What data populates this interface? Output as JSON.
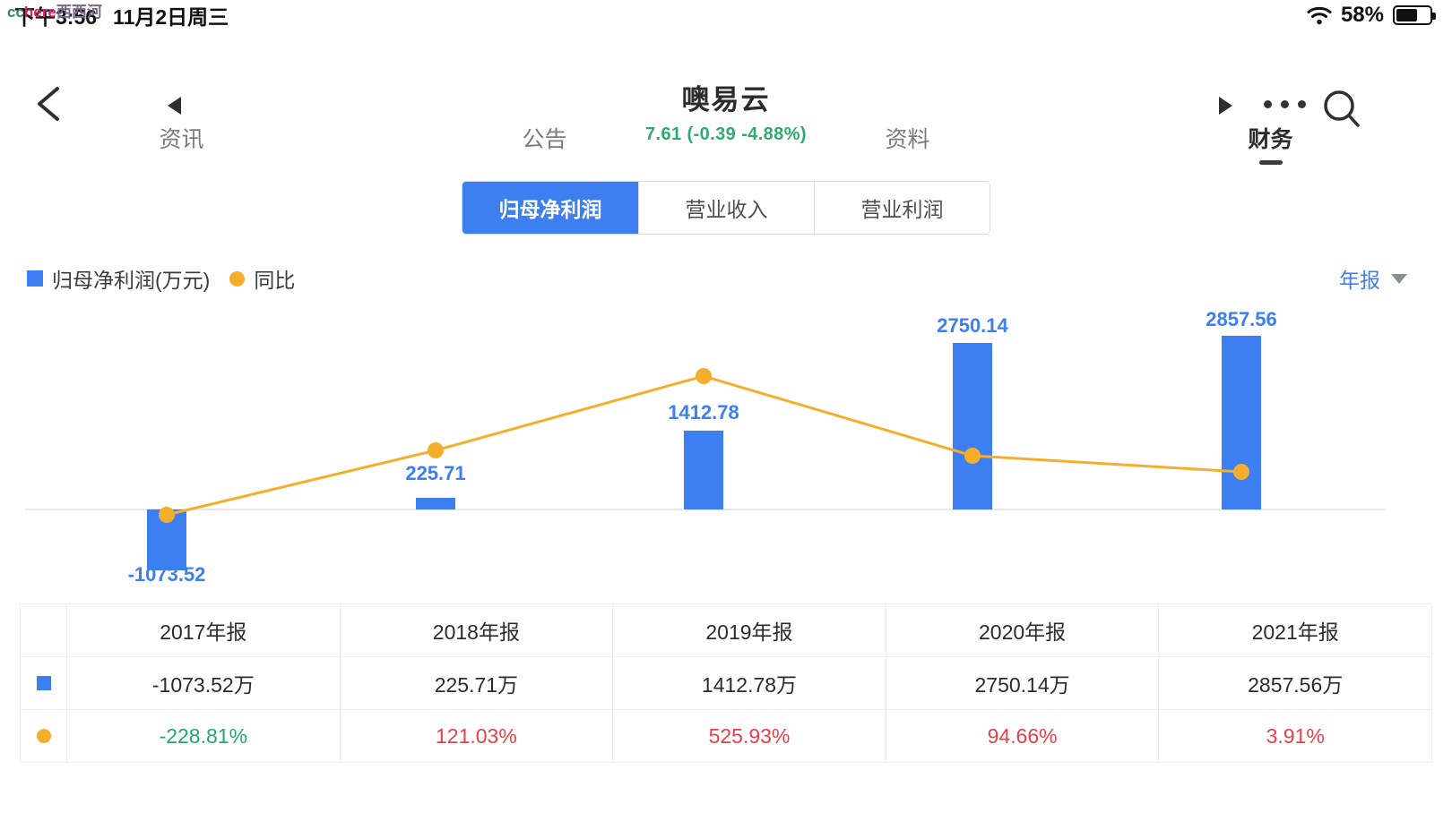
{
  "statusbar": {
    "time": "下午3:56",
    "date": "11月2日周三",
    "battery_pct": "58%",
    "watermark": {
      "part1": "cc",
      "part2": "here",
      "part3": "西西河"
    },
    "wifi_icon": "wifi-icon",
    "battery_icon": "battery-icon"
  },
  "header": {
    "back_icon": "chevron-left-icon",
    "prev_icon": "triangle-left-icon",
    "next_icon": "triangle-right-icon",
    "more_icon": "ellipsis-icon",
    "search_icon": "search-icon",
    "title": "噢易云",
    "quote": "7.61 (-0.39 -4.88%)",
    "quote_color": "#2bab6e"
  },
  "tabs": [
    {
      "label": "资讯",
      "active": false
    },
    {
      "label": "公告",
      "active": false
    },
    {
      "label": "资料",
      "active": false
    },
    {
      "label": "财务",
      "active": true
    }
  ],
  "segments": [
    {
      "label": "归母净利润",
      "active": true
    },
    {
      "label": "营业收入",
      "active": false
    },
    {
      "label": "营业利润",
      "active": false
    }
  ],
  "legend": [
    {
      "marker": "square",
      "label": "归母净利润(万元)",
      "color": "#3d7ff0"
    },
    {
      "marker": "dot",
      "label": "同比",
      "color": "#f5ae2c"
    }
  ],
  "period_selector": {
    "label": "年报",
    "caret_icon": "caret-down-icon"
  },
  "chart_data": {
    "type": "bar",
    "title": "归母净利润(万元)",
    "categories": [
      "2017年报",
      "2018年报",
      "2019年报",
      "2020年报",
      "2021年报"
    ],
    "series": [
      {
        "name": "归母净利润(万元)",
        "type": "bar",
        "color": "#3d7ff0",
        "values": [
          -1073.52,
          225.71,
          1412.78,
          2750.14,
          2857.56
        ],
        "labels": [
          "-1073.52",
          "225.71",
          "1412.78",
          "2750.14",
          "2857.56"
        ]
      },
      {
        "name": "同比",
        "type": "line",
        "color": "#f5ae2c",
        "values": [
          -228.81,
          121.03,
          525.93,
          94.66,
          3.91
        ],
        "unit": "%"
      }
    ],
    "ylim": [
      -1200,
      3000
    ],
    "grid": false,
    "legend_position": "top-left",
    "zero_line": true
  },
  "table": {
    "columns": [
      "",
      "2017年报",
      "2018年报",
      "2019年报",
      "2020年报",
      "2021年报"
    ],
    "rows": [
      {
        "marker": "square",
        "values": [
          "-1073.52万",
          "225.71万",
          "1412.78万",
          "2750.14万",
          "2857.56万"
        ],
        "value_colors": [
          "#2b2b2b",
          "#2b2b2b",
          "#2b2b2b",
          "#2b2b2b",
          "#2b2b2b"
        ]
      },
      {
        "marker": "dot",
        "values": [
          "-228.81%",
          "121.03%",
          "525.93%",
          "94.66%",
          "3.91%"
        ],
        "value_colors": [
          "#1faa6a",
          "#e8404a",
          "#e8404a",
          "#e8404a",
          "#e8404a"
        ]
      }
    ]
  }
}
